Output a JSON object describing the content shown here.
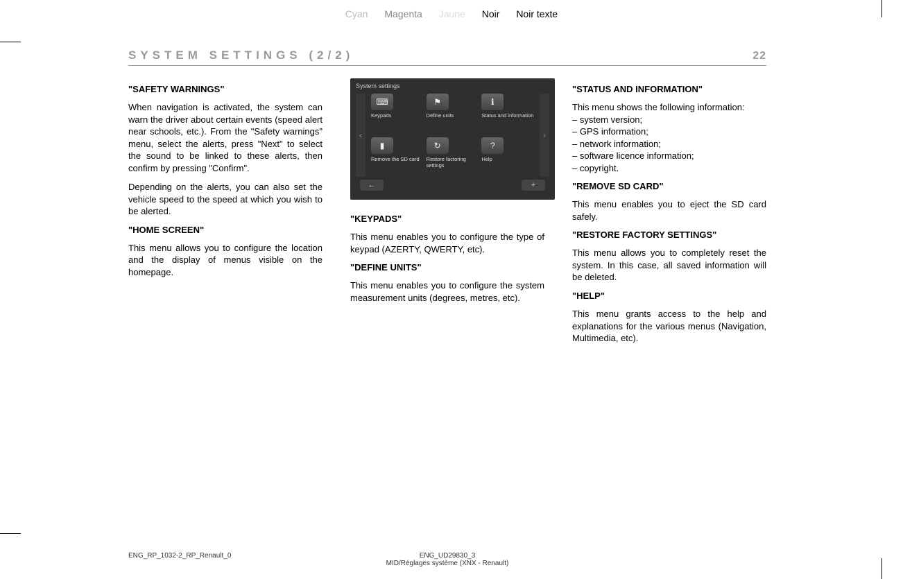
{
  "color_bar": {
    "cyan": "Cyan",
    "magenta": "Magenta",
    "jaune": "Jaune",
    "noir": "Noir",
    "noir_texte": "Noir texte"
  },
  "header": {
    "title": "SYSTEM SETTINGS (2/2)",
    "page_number": "22"
  },
  "col1": {
    "h_safety": "\"SAFETY WARNINGS\"",
    "p_safety1": "When navigation is activated, the system can warn the driver about certain events (speed alert near schools, etc.). From the \"Safety warnings\" menu, select the alerts, press \"Next\" to select the sound to be linked to these alerts, then confirm by pressing \"Confirm\".",
    "p_safety2": "Depending on the alerts, you can also set the vehicle speed to the speed at which you wish to be alerted.",
    "h_home": "\"HOME SCREEN\"",
    "p_home": "This menu allows you to configure the location and the display of menus visible on the homepage."
  },
  "device": {
    "title": "System settings",
    "tiles": [
      {
        "label": "Keypads",
        "glyph": "⌨"
      },
      {
        "label": "Define units",
        "glyph": "⚑"
      },
      {
        "label": "Status and information",
        "glyph": "ℹ"
      },
      {
        "label": "Remove the SD card",
        "glyph": "▮"
      },
      {
        "label": "Restore factoring settings",
        "glyph": "↻"
      },
      {
        "label": "Help",
        "glyph": "?"
      }
    ],
    "nav_left": "‹",
    "nav_right": "›",
    "btn_back": "←",
    "btn_plus": "+"
  },
  "col2": {
    "h_keypads": "\"KEYPADS\"",
    "p_keypads": "This menu enables you to configure the type of keypad (AZERTY, QWERTY, etc).",
    "h_units": "\"DEFINE UNITS\"",
    "p_units": "This menu enables you to configure the system measurement units (degrees, metres, etc)."
  },
  "col3": {
    "h_status": "\"STATUS AND INFORMATION\"",
    "p_status_intro": "This menu shows the following information:",
    "li1": "– system version;",
    "li2": "– GPS information;",
    "li3": "– network information;",
    "li4": "– software licence information;",
    "li5": "– copyright.",
    "h_remove": "\"REMOVE SD CARD\"",
    "p_remove": "This menu enables you to eject the SD card safely.",
    "h_restore": "\"RESTORE FACTORY SETTINGS\"",
    "p_restore": "This menu allows you to completely reset the system. In this case, all saved information will be deleted.",
    "h_help": "\"HELP\"",
    "p_help": "This menu grants access to the help and explanations for the various menus (Navigation, Multimedia, etc)."
  },
  "footer": {
    "left": "ENG_RP_1032-2_RP_Renault_0",
    "center1": "ENG_UD29830_3",
    "center2": "MID/Réglages système (XNX - Renault)"
  }
}
